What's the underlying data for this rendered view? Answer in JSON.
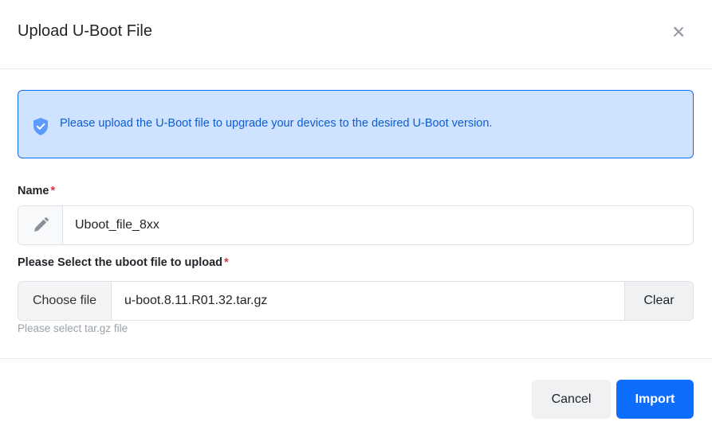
{
  "modal": {
    "title": "Upload U-Boot File",
    "close_icon": "close-icon"
  },
  "alert": {
    "icon": "shield-check-icon",
    "message": "Please upload the U-Boot file to upgrade your devices to the desired U-Boot version.",
    "colors": {
      "background": "#cfe2ff",
      "border": "#0d6efd",
      "text": "#0b5ed7"
    }
  },
  "name_field": {
    "label": "Name",
    "required_mark": "*",
    "icon": "pencil-icon",
    "value": "Uboot_file_8xx"
  },
  "file_field": {
    "label": "Please Select the uboot file to upload",
    "required_mark": "*",
    "choose_label": "Choose file",
    "file_name": "u-boot.8.11.R01.32.tar.gz",
    "clear_label": "Clear",
    "hint": "Please select tar.gz file"
  },
  "footer": {
    "cancel_label": "Cancel",
    "import_label": "Import",
    "colors": {
      "primary": "#0d6efd"
    }
  }
}
